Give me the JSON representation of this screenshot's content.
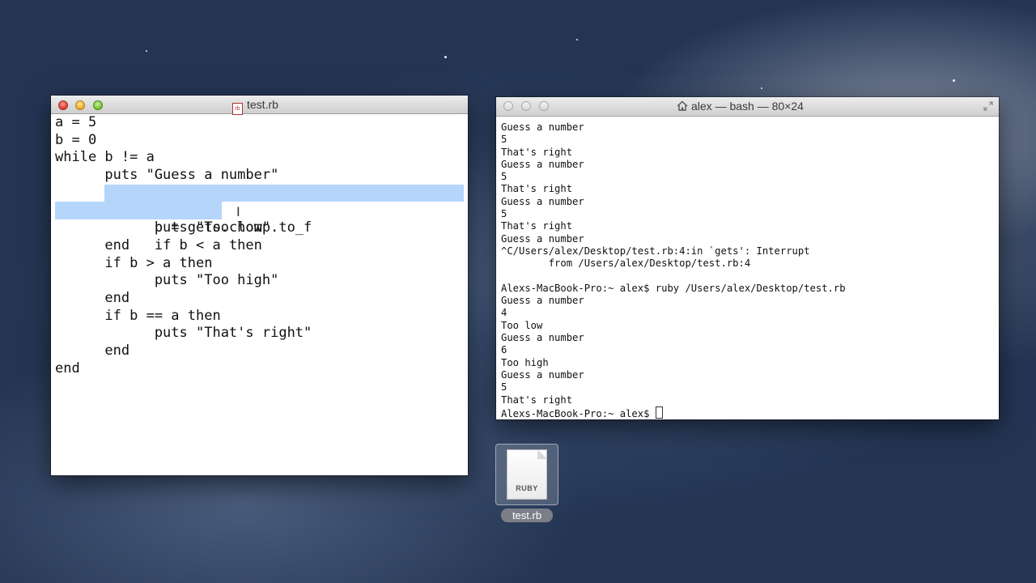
{
  "editor": {
    "title": "test.rb",
    "file_badge": "rb",
    "lines": [
      "a = 5",
      "b = 0",
      "while b != a",
      "      puts \"Guess a number\"",
      "      b = gets.chomp.to_f",
      "      if b < a then",
      "            puts \"Too low\"",
      "      end",
      "      if b > a then",
      "            puts \"Too high\"",
      "      end",
      "      if b == a then",
      "            puts \"That's right\"",
      "      end",
      "end"
    ]
  },
  "terminal": {
    "title": "alex — bash — 80×24",
    "lines": [
      "Guess a number",
      "5",
      "That's right",
      "Guess a number",
      "5",
      "That's right",
      "Guess a number",
      "5",
      "That's right",
      "Guess a number",
      "^C/Users/alex/Desktop/test.rb:4:in `gets': Interrupt",
      "        from /Users/alex/Desktop/test.rb:4",
      "",
      "Alexs-MacBook-Pro:~ alex$ ruby /Users/alex/Desktop/test.rb",
      "Guess a number",
      "4",
      "Too low",
      "Guess a number",
      "6",
      "Too high",
      "Guess a number",
      "5",
      "That's right"
    ],
    "prompt": "Alexs-MacBook-Pro:~ alex$ "
  },
  "desktop_file": {
    "name": "test.rb",
    "tag": "RUBY"
  }
}
